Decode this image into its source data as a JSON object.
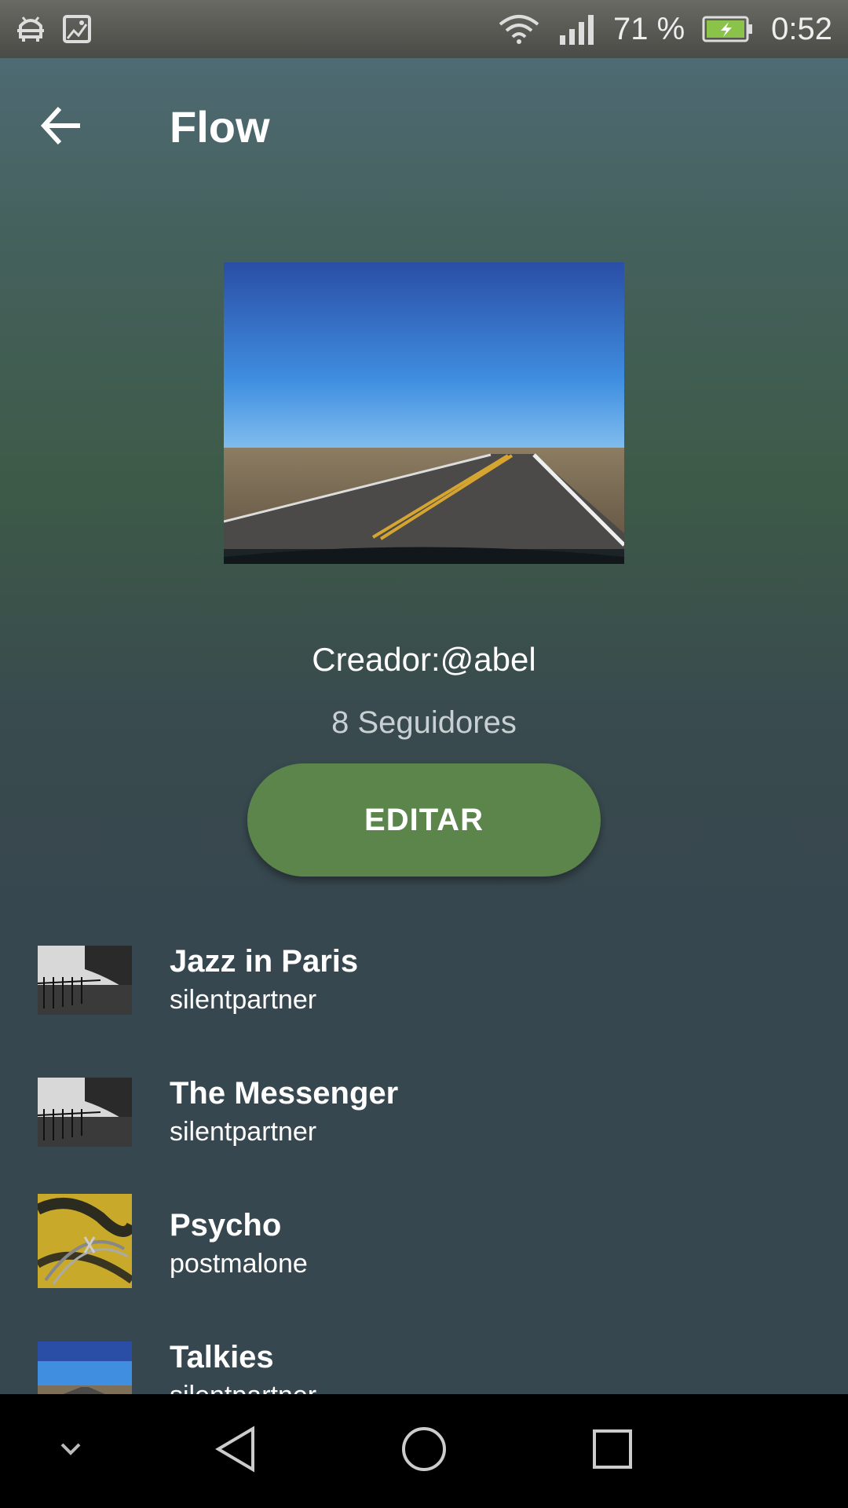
{
  "status_bar": {
    "battery_percent": "71 %",
    "time": "0:52",
    "icons": [
      "android-debug-icon",
      "image-icon",
      "wifi-icon",
      "signal-icon",
      "battery-charging-icon"
    ]
  },
  "app_bar": {
    "title": "Flow",
    "back_icon": "arrow-back-icon"
  },
  "playlist": {
    "creator": "Creador:@abel",
    "followers": "8 Seguidores",
    "edit_label": "EDITAR"
  },
  "tracks": [
    {
      "title": "Jazz in Paris",
      "artist": "silentpartner"
    },
    {
      "title": "The Messenger",
      "artist": "silentpartner"
    },
    {
      "title": "Psycho",
      "artist": "postmalone"
    },
    {
      "title": "Talkies",
      "artist": "silentpartner"
    }
  ],
  "nav_bar": {
    "icons": [
      "chevron-down-icon",
      "back-triangle-icon",
      "home-circle-icon",
      "recents-square-icon"
    ]
  },
  "colors": {
    "accent_button": "#5c854c",
    "background": "#37474f"
  }
}
